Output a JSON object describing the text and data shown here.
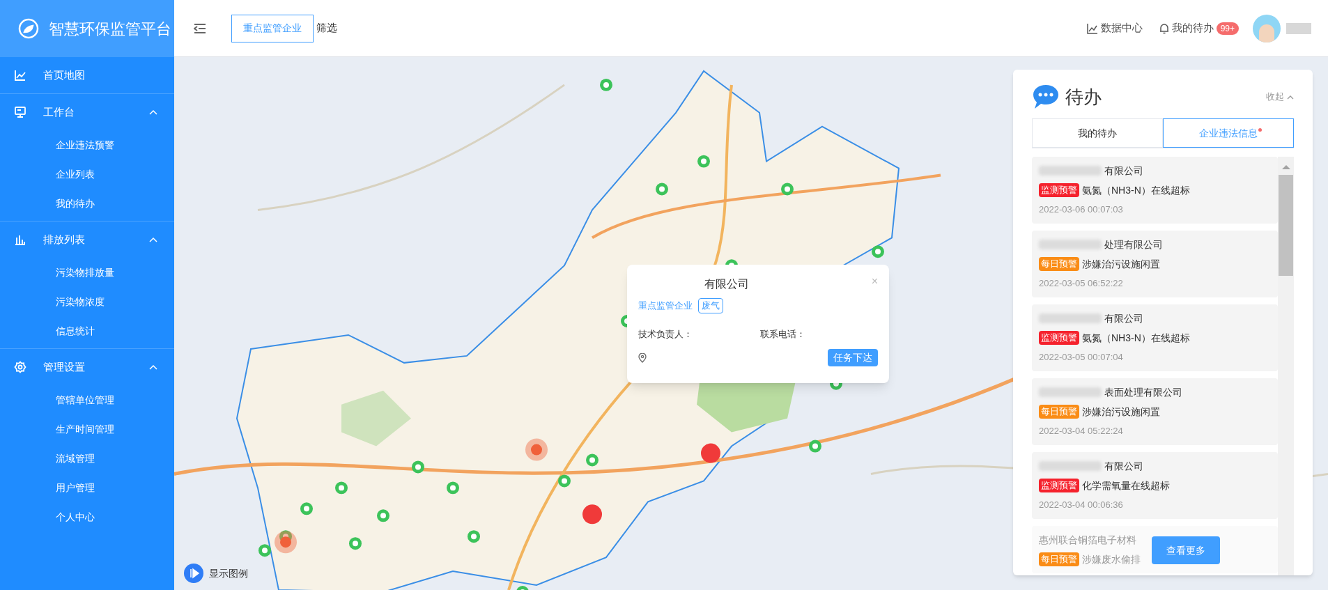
{
  "header": {
    "logo_title": "智慧环保监管平台",
    "filter_button": "重点监管企业",
    "filter_label": "筛选",
    "data_center": "数据中心",
    "todo": {
      "label": "我的待办",
      "badge": "99+"
    }
  },
  "sidebar": {
    "items": [
      {
        "label": "首页地图",
        "kind": "link"
      },
      {
        "label": "工作台",
        "kind": "group",
        "expanded": true,
        "children": [
          {
            "label": "企业违法预警"
          },
          {
            "label": "企业列表"
          },
          {
            "label": "我的待办"
          }
        ]
      },
      {
        "label": "排放列表",
        "kind": "group",
        "expanded": true,
        "children": [
          {
            "label": "污染物排放量"
          },
          {
            "label": "污染物浓度"
          },
          {
            "label": "信息统计"
          }
        ]
      },
      {
        "label": "管理设置",
        "kind": "group",
        "expanded": true,
        "children": [
          {
            "label": "管辖单位管理"
          },
          {
            "label": "生产时间管理"
          },
          {
            "label": "流域管理"
          },
          {
            "label": "用户管理"
          },
          {
            "label": "个人中心"
          }
        ]
      }
    ]
  },
  "map": {
    "legend_button": "显示图例",
    "popup": {
      "company": "有限公司",
      "close": "×",
      "tags": [
        {
          "label": "重点监管企业",
          "kind": "text"
        },
        {
          "label": "废气",
          "kind": "outlined"
        }
      ],
      "tech_label": "技术负责人：",
      "phone_label": "联系电话：",
      "action": "任务下达"
    }
  },
  "todo_panel": {
    "title": "待办",
    "collapse": "收起",
    "tabs": [
      {
        "label": "我的待办",
        "selected": false,
        "dot": false
      },
      {
        "label": "企业违法信息",
        "selected": true,
        "dot": true
      }
    ],
    "items": [
      {
        "company": "有限公司",
        "redacted": true,
        "tag": {
          "label": "监测预警",
          "color": "#f5222d"
        },
        "text": "氨氮（NH3-N）在线超标",
        "time": "2022-03-06 00:07:03",
        "faded": false
      },
      {
        "company": "处理有限公司",
        "redacted": true,
        "tag": {
          "label": "每日预警",
          "color": "#fa8c16"
        },
        "text": "涉嫌治污设施闲置",
        "time": "2022-03-05 06:52:22",
        "faded": false
      },
      {
        "company": "有限公司",
        "redacted": true,
        "tag": {
          "label": "监测预警",
          "color": "#f5222d"
        },
        "text": "氨氮（NH3-N）在线超标",
        "time": "2022-03-05 00:07:04",
        "faded": false
      },
      {
        "company": "表面处理有限公司",
        "redacted": true,
        "tag": {
          "label": "每日预警",
          "color": "#fa8c16"
        },
        "text": "涉嫌治污设施闲置",
        "time": "2022-03-04 05:22:24",
        "faded": false
      },
      {
        "company": "有限公司",
        "redacted": true,
        "tag": {
          "label": "监测预警",
          "color": "#f5222d"
        },
        "text": "化学需氧量在线超标",
        "time": "2022-03-04 00:06:36",
        "faded": false
      },
      {
        "company": "惠州联合铜箔电子材料",
        "redacted": false,
        "tag": {
          "label": "每日预警",
          "color": "#fa8c16"
        },
        "text": "涉嫌废水偷排",
        "faded": true
      }
    ],
    "more_button": "查看更多"
  }
}
